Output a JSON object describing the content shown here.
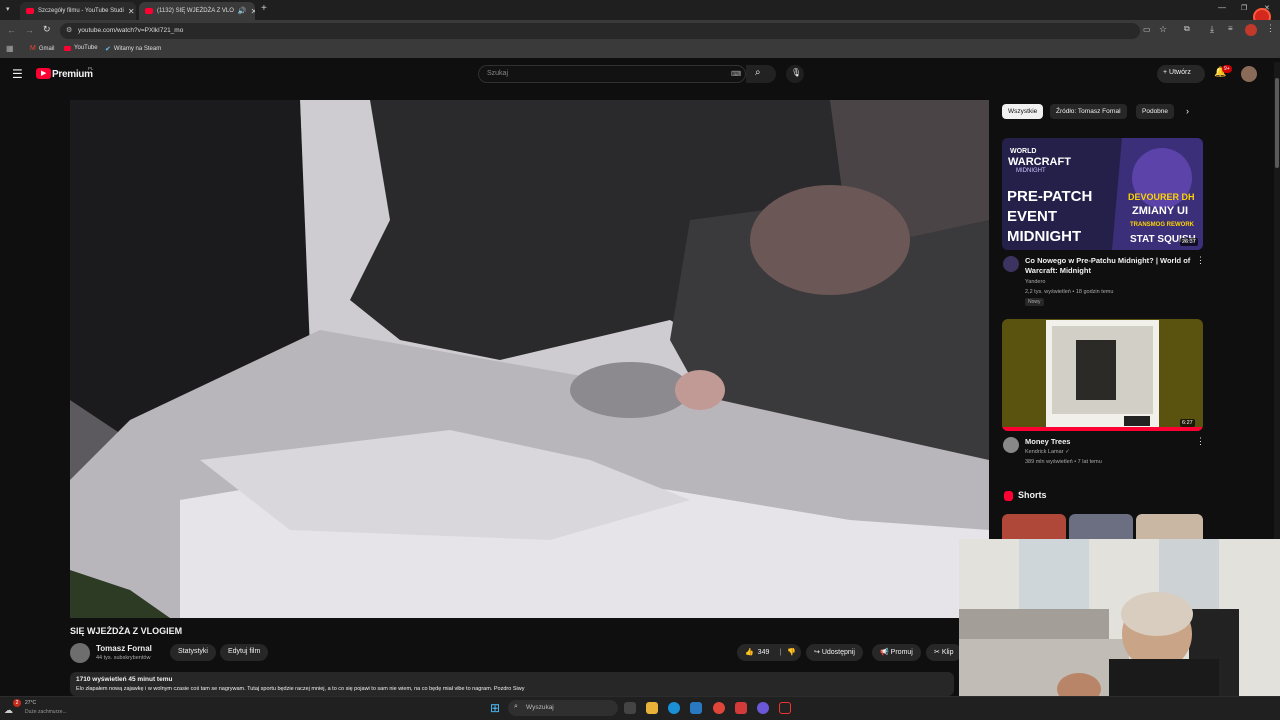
{
  "browser": {
    "tabs": [
      {
        "title": "Szczegóły filmu - YouTube Studi"
      },
      {
        "title": "(1132) SIĘ WJEŻDŻA Z VLO"
      }
    ],
    "new_tab_icon": "+",
    "url": "youtube.com/watch?v=PXlkI721_mo",
    "bookmarks": [
      "Gmail",
      "YouTube",
      "Witamy na Steam"
    ],
    "window_controls": [
      "minimize",
      "restore",
      "close"
    ]
  },
  "header": {
    "logo_text": "Premium",
    "logo_superscript": "PL",
    "search_placeholder": "Szukaj",
    "create_label": "Utwórz",
    "notifications_count": "9+"
  },
  "video": {
    "title": "SIĘ WJEŻDŻA Z VLOGIEM",
    "channel": "Tomasz Fornal",
    "subscribers": "44 tys. subskrybentów",
    "stats_label": "Statystyki",
    "edit_label": "Edytuj film",
    "likes": "349",
    "share_label": "Udostępnij",
    "promote_label": "Promuj",
    "clip_label": "Klip",
    "views_time": "1710 wyświetleń  45 minut temu",
    "description": "Elo złapałem nową zajawkę i w wolnym czasie coś tam se nagrywam. Tutaj sportu będzie raczej mniej, a to co się pojawi to sam nie wiem, na co będę miał vibe to nagram. Pozdro Siwy"
  },
  "sidebar": {
    "chips": [
      "Wszystkie",
      "Źródło: Tomasz Fornal",
      "Podobne"
    ],
    "recommendations": [
      {
        "title": "Co Nowego w Pre-Patchu Midnight? | World of Warcraft: Midnight",
        "channel": "Yandero",
        "meta": "2,2 tys. wyświetleń • 18 godzin temu",
        "badge": "Nowy",
        "duration": "26:37",
        "thumb_text": [
          "WORLD",
          "WARCRAFT",
          "MIDNIGHT",
          "PRE-PATCH",
          "EVENT",
          "MIDNIGHT",
          "DEVOURER DH",
          "ZMIANY UI",
          "TRANSMOG REWORK",
          "STAT SQUISH"
        ]
      },
      {
        "title": "Money Trees",
        "channel": "Kendrick Lamar",
        "meta": "389 mln wyświetleń • 7 lat temu",
        "duration": "6:27"
      }
    ],
    "shorts_label": "Shorts"
  },
  "taskbar": {
    "weather": "27°C",
    "weather_sub": "Duże zachmurze...",
    "search_placeholder": "Wyszukaj",
    "notification_badge": "2"
  },
  "colors": {
    "youtube_red": "#ff0033",
    "background": "#0f0f0f",
    "chip_bg": "#272727"
  }
}
